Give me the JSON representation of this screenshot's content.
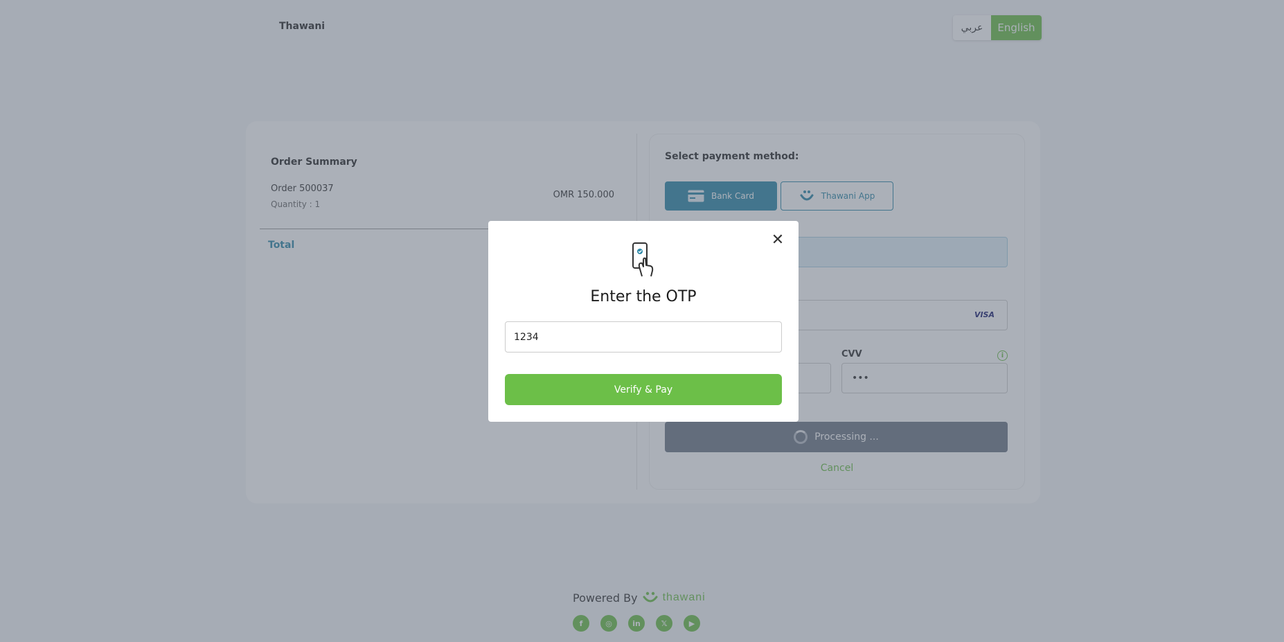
{
  "header": {
    "brand": "Thawani",
    "lang_arabic": "عربي",
    "lang_english": "English"
  },
  "order": {
    "title": "Order Summary",
    "name": "Order 500037",
    "quantity": "Quantity : 1",
    "price": "OMR 150.000",
    "total_label": "Total"
  },
  "payment": {
    "title": "Select payment method:",
    "bank_card": "Bank Card",
    "thawani_app": "Thawani App",
    "card_brand": "VISA",
    "cvv_label": "CVV",
    "cvv_value": "•••",
    "processing": "Processing ...",
    "cancel": "Cancel"
  },
  "footer": {
    "powered_by": "Powered By",
    "logo_text": "thawani",
    "socials": [
      "facebook-icon",
      "instagram-icon",
      "linkedin-icon",
      "x-icon",
      "youtube-icon"
    ]
  },
  "modal": {
    "title": "Enter the OTP",
    "otp_value": "1234",
    "verify_label": "Verify & Pay",
    "close_glyph": "✕"
  },
  "colors": {
    "brand_green": "#6cbf48",
    "brand_blue": "#2f89a8",
    "processing_gray": "#6f7887"
  }
}
